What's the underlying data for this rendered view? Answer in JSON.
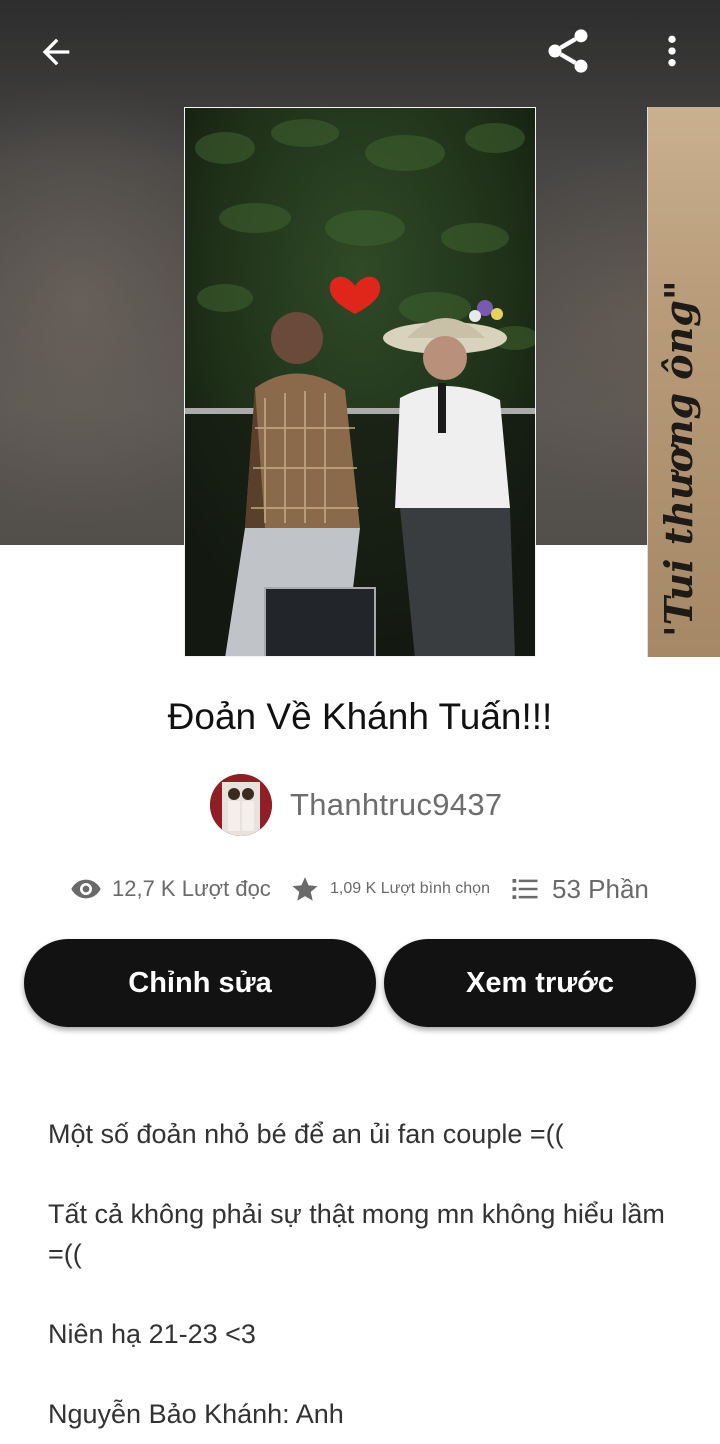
{
  "header": {
    "back_icon": "arrow-left-icon",
    "share_icon": "share-icon",
    "more_icon": "more-vertical-icon"
  },
  "cover": {
    "next_cover_text": "'Tui thương ông\""
  },
  "story": {
    "title": "Đoản Về Khánh Tuấn!!!",
    "author": "Thanhtruc9437"
  },
  "stats": {
    "reads": "12,7 K Lượt đọc",
    "votes": "1,09 K Lượt bình chọn",
    "parts": "53 Phần"
  },
  "actions": {
    "edit_label": "Chỉnh sửa",
    "preview_label": "Xem trước"
  },
  "description": {
    "lines": [
      "Một số đoản nhỏ bé để an ủi fan couple =((",
      "Tất cả không phải sự thật mong mn không hiểu lầm =((",
      "Niên hạ 21-23 <3",
      "Nguyễn Bảo Khánh: Anh"
    ]
  },
  "colors": {
    "button_bg": "#121212",
    "button_text": "#ffffff",
    "muted_text": "#6a6a6a",
    "heart": "#e0251b"
  }
}
